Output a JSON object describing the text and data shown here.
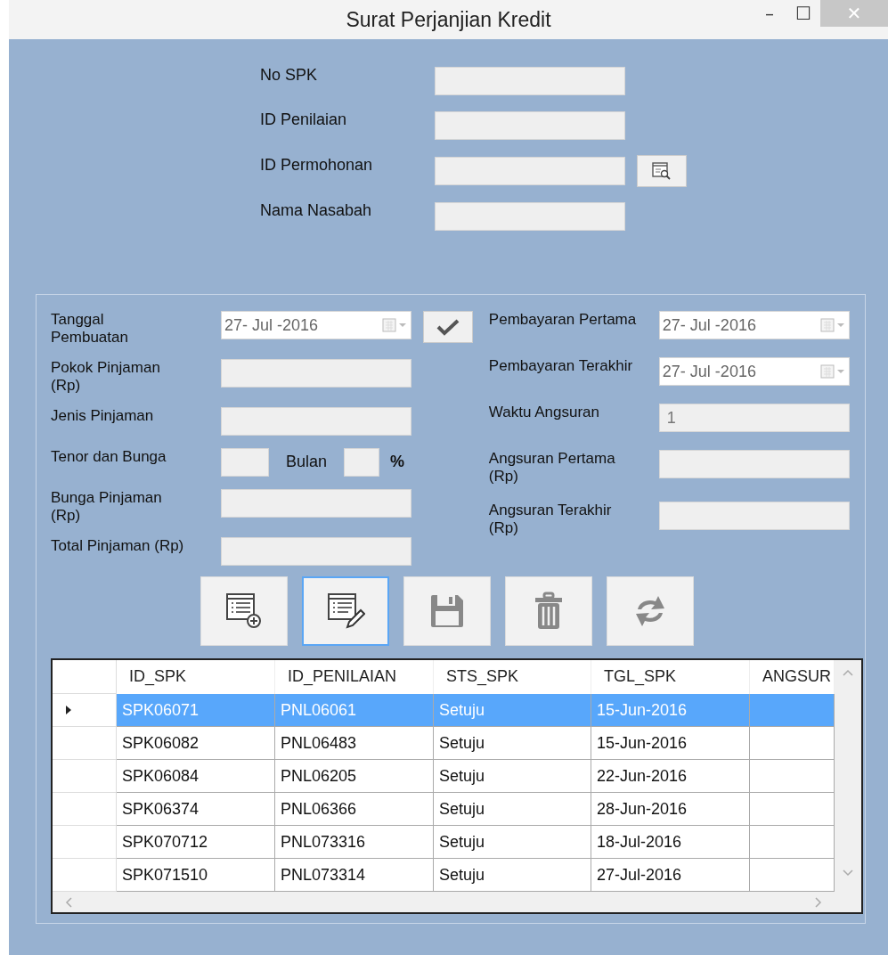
{
  "window": {
    "title": "Surat Perjanjian Kredit",
    "controls": [
      "–",
      "☐",
      "✕"
    ]
  },
  "top_fields": [
    {
      "label": "No SPK",
      "has_lookup": false
    },
    {
      "label": "ID Penilaian",
      "has_lookup": false
    },
    {
      "label": "ID Permohonan",
      "has_lookup": true
    },
    {
      "label": "Nama Nasabah",
      "has_lookup": false
    }
  ],
  "left_fields": [
    {
      "kind": "date",
      "label": "Tanggal Pembuatan",
      "value": "27- Jul -2016",
      "confirm": true
    },
    {
      "kind": "text",
      "label": "Pokok Pinjaman (Rp)"
    },
    {
      "kind": "text",
      "label": "Jenis Pinjaman"
    },
    {
      "kind": "split",
      "label": "Tenor dan Bunga",
      "unit1": "Bulan",
      "unit2": "%"
    },
    {
      "kind": "text",
      "label": "Bunga Pinjaman (Rp)"
    },
    {
      "kind": "text",
      "label": "Total Pinjaman (Rp)"
    }
  ],
  "right_fields": [
    {
      "kind": "date",
      "label": "Pembayaran Pertama",
      "value": "27- Jul -2016"
    },
    {
      "kind": "date",
      "label": "Pembayaran Terakhir",
      "value": "27- Jul -2016"
    },
    {
      "kind": "text",
      "label": "Waktu Angsuran",
      "value": "1"
    },
    {
      "kind": "text",
      "label": "Angsuran Pertama (Rp)"
    },
    {
      "kind": "text",
      "label": "Angsuran Terakhir (Rp)"
    }
  ],
  "toolbar": [
    {
      "kind": "add",
      "selected": false
    },
    {
      "kind": "edit",
      "selected": true
    },
    {
      "kind": "save",
      "selected": false
    },
    {
      "kind": "delete",
      "selected": false
    },
    {
      "kind": "refresh",
      "selected": false
    }
  ],
  "table": {
    "columns": [
      "ID_SPK",
      "ID_PENILAIAN",
      "STS_SPK",
      "TGL_SPK",
      "ANGSUR"
    ],
    "rows": [
      {
        "cells": [
          "SPK06071",
          "PNL06061",
          "Setuju",
          "15-Jun-2016",
          ""
        ],
        "selected": true
      },
      {
        "cells": [
          "SPK06082",
          "PNL06483",
          "Setuju",
          "15-Jun-2016",
          ""
        ],
        "selected": false
      },
      {
        "cells": [
          "SPK06084",
          "PNL06205",
          "Setuju",
          "22-Jun-2016",
          ""
        ],
        "selected": false
      },
      {
        "cells": [
          "SPK06374",
          "PNL06366",
          "Setuju",
          "28-Jun-2016",
          ""
        ],
        "selected": false
      },
      {
        "cells": [
          "SPK070712",
          "PNL073316",
          "Setuju",
          "18-Jul-2016",
          ""
        ],
        "selected": false
      },
      {
        "cells": [
          "SPK071510",
          "PNL073314",
          "Setuju",
          "27-Jul-2016",
          ""
        ],
        "selected": false
      }
    ]
  }
}
